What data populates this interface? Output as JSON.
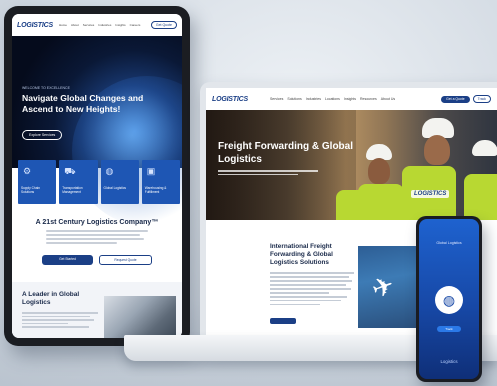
{
  "brand": {
    "logo_text": "LOGISTICS"
  },
  "tablet": {
    "nav": {
      "links": [
        "Home",
        "About",
        "Services",
        "Industries",
        "Insights",
        "Careers",
        "Contact"
      ],
      "button_label": "Get Quote"
    },
    "hero": {
      "kicker": "WELCOME TO EXCELLENCE",
      "title": "Navigate Global Changes and Ascend to New Heights!",
      "button_label": "Explore Services"
    },
    "cards": [
      {
        "label": "Supply Chain Solutions",
        "icon": "gear-icon"
      },
      {
        "label": "Transportation Management",
        "icon": "truck-icon"
      },
      {
        "label": "Global Logistics",
        "icon": "globe-icon"
      },
      {
        "label": "Warehousing & Fulfillment",
        "icon": "box-icon"
      }
    ],
    "section": {
      "title": "A 21st Century Logistics Company™",
      "primary_button": "Get Started",
      "secondary_button": "Request Quote"
    },
    "leader": {
      "title": "A Leader in Global Logistics"
    }
  },
  "laptop": {
    "nav": {
      "links": [
        "Services",
        "Solutions",
        "Industries",
        "Locations",
        "Insights",
        "Resources",
        "About Us"
      ],
      "button_primary": "Get a Quote",
      "button_secondary": "Track"
    },
    "hero": {
      "title": "Freight Forwarding & Global Logistics",
      "logo_text": "LOGISTICS"
    },
    "section": {
      "title": "International Freight Forwarding & Global Logistics Solutions"
    }
  },
  "phone": {
    "title": "Global Logistics",
    "button_label": "Track",
    "footer": "Logistics"
  },
  "colors": {
    "primary": "#1b3f86",
    "card_blue": "#1e56b4",
    "vest": "#b8d832",
    "phone_blue": "#1e62cf"
  }
}
